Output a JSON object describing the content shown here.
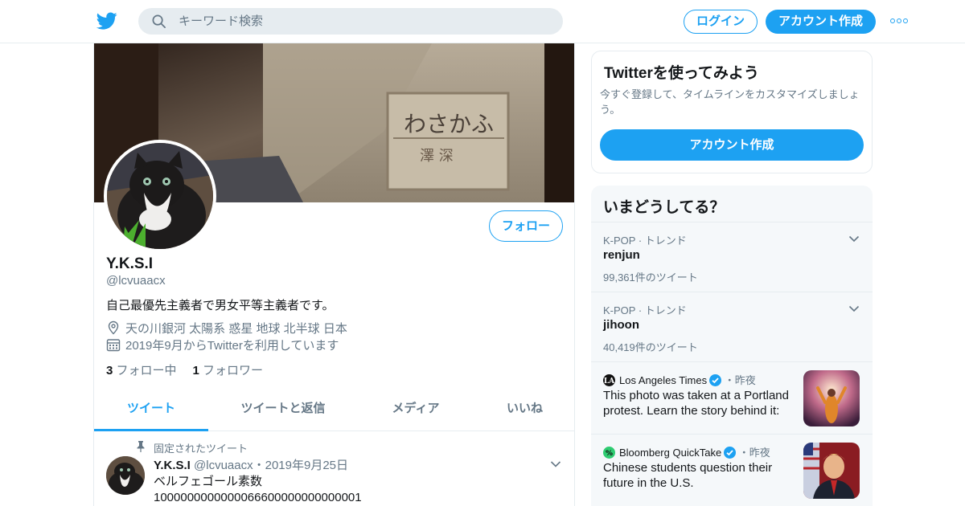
{
  "header": {
    "search_placeholder": "キーワード検索",
    "login_label": "ログイン",
    "signup_label": "アカウント作成"
  },
  "profile": {
    "follow_label": "フォロー",
    "display_name": "Y.K.S.I",
    "handle": "@lcvuaacx",
    "bio": "自己最優先主義者で男女平等主義者です。",
    "location": "天の川銀河 太陽系 惑星 地球 北半球 日本",
    "joined": "2019年9月からTwitterを利用しています",
    "following_count": "3",
    "following_label": "フォロー中",
    "followers_count": "1",
    "followers_label": "フォロワー",
    "banner_sign_hiragana": "わさかふ",
    "banner_sign_kanji": "澤 深"
  },
  "tabs": [
    {
      "label": "ツイート",
      "active": true
    },
    {
      "label": "ツイートと返信",
      "active": false
    },
    {
      "label": "メディア",
      "active": false
    },
    {
      "label": "いいね",
      "active": false
    }
  ],
  "pinned_tweet": {
    "pinned_label": "固定されたツイート",
    "name": "Y.K.S.I",
    "handle": "@lcvuaacx",
    "date": "・2019年9月25日",
    "line1": "ベルフェゴール素数",
    "line2": "1000000000000066600000000000001"
  },
  "signup_card": {
    "title": "Twitterを使ってみよう",
    "description": "今すぐ登録して、タイムラインをカスタマイズしましょう。",
    "button_label": "アカウント作成"
  },
  "trends": {
    "title": "いまどうしてる？",
    "items": [
      {
        "context": "K-POP · トレンド",
        "name": "renjun",
        "count": "99,361件のツイート"
      },
      {
        "context": "K-POP · トレンド",
        "name": "jihoon",
        "count": "40,419件のツイート"
      }
    ],
    "news": [
      {
        "source": "Los Angeles Times",
        "when": "・昨夜",
        "headline": "This photo was taken at a Portland protest. Learn the story behind it:"
      },
      {
        "source": "Bloomberg QuickTake",
        "when": "・昨夜",
        "headline": "Chinese students question their future in the U.S."
      }
    ]
  },
  "colors": {
    "accent": "#1da1f2",
    "text": "#14171a",
    "muted": "#657786",
    "border": "#e6ecf0",
    "panel": "#f5f8fa"
  }
}
